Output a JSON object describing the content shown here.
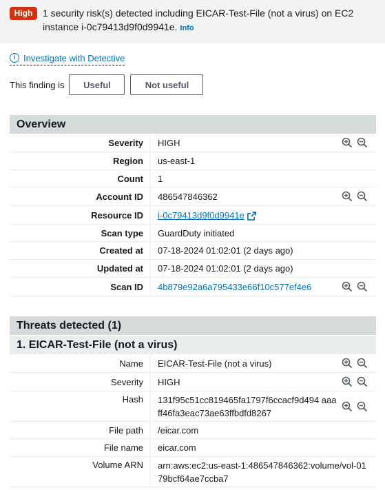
{
  "header": {
    "severity_badge": "High",
    "title": "1 security risk(s) detected including EICAR-Test-File (not a virus) on EC2 instance i-0c79413d9f0d9941e.",
    "info_link": "Info"
  },
  "detective_link": "Investigate with Detective",
  "feedback": {
    "label": "This finding is",
    "useful": "Useful",
    "not_useful": "Not useful"
  },
  "overview": {
    "title": "Overview",
    "rows": [
      {
        "label": "Severity",
        "value": "HIGH"
      },
      {
        "label": "Region",
        "value": "us-east-1"
      },
      {
        "label": "Count",
        "value": "1"
      },
      {
        "label": "Account ID",
        "value": "486547846362"
      },
      {
        "label": "Resource ID",
        "value": "i-0c79413d9f0d9941e"
      },
      {
        "label": "Scan type",
        "value": "GuardDuty initiated"
      },
      {
        "label": "Created at",
        "value": "07-18-2024 01:02:01 (2 days ago)"
      },
      {
        "label": "Updated at",
        "value": "07-18-2024 01:02:01 (2 days ago)"
      },
      {
        "label": "Scan ID",
        "value": "4b879e92a6a795433e66f10c577ef4e6"
      }
    ]
  },
  "threats": {
    "title": "Threats detected (1)",
    "threat_title": "1. EICAR-Test-File (not a virus)",
    "rows": [
      {
        "label": "Name",
        "value": "EICAR-Test-File (not a virus)"
      },
      {
        "label": "Severity",
        "value": "HIGH"
      },
      {
        "label": "Hash",
        "value": "131f95c51cc819465fa1797f6ccacf9d494 aaaff46fa3eac73ae63ffbdfd8267"
      },
      {
        "label": "File path",
        "value": "/eicar.com"
      },
      {
        "label": "File name",
        "value": "eicar.com"
      },
      {
        "label": "Volume ARN",
        "value": "arn:aws:ec2:us-east-1:486547846362:volume/vol-0179bcf64ae7ccba7"
      }
    ]
  },
  "colors": {
    "link": "#0073bb",
    "high": "#d13212",
    "section_bg": "#d5dbdb"
  }
}
